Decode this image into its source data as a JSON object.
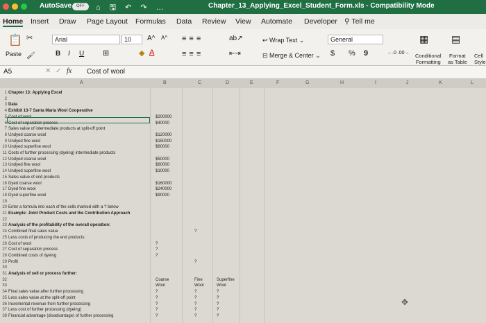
{
  "titlebar": {
    "autosave": "AutoSave",
    "toggle": "OFF",
    "quick": "⌂ 🖫 ↶ ↷ …",
    "doc_title": "Chapter_13_Applying_Excel_Student_Form.xls  -  Compatibility Mode"
  },
  "tabs": [
    "Home",
    "Insert",
    "Draw",
    "Page Layout",
    "Formulas",
    "Data",
    "Review",
    "View",
    "Automate",
    "Developer",
    "Tell me"
  ],
  "ribbon": {
    "paste": "Paste",
    "font": "Arial",
    "size": "10",
    "bold": "B",
    "italic": "I",
    "underline": "U",
    "wrap": "Wrap Text",
    "merge": "Merge & Center",
    "numfmt": "General",
    "currency": "$",
    "percent": "%",
    "comma": "9",
    "cond1": "Conditional",
    "cond2": "Formatting",
    "fmt1": "Format",
    "fmt2": "as Table",
    "cell1": "Cell",
    "cell2": "Style"
  },
  "formula": {
    "cell_ref": "A5",
    "fx": "fx",
    "value": "Cost of wool"
  },
  "columns": [
    "A",
    "B",
    "C",
    "D",
    "E",
    "F",
    "G",
    "H",
    "I",
    "J",
    "K",
    "L"
  ],
  "rows": [
    {
      "n": "1",
      "a": "Chapter 13: Applying Excel",
      "bold": true
    },
    {
      "n": "2",
      "a": ""
    },
    {
      "n": "3",
      "a": "Data",
      "bold": true
    },
    {
      "n": "4",
      "a": "Exhibit 13-7 Santa Maria Wool Cooperative",
      "bold": true
    },
    {
      "n": "5",
      "a": "Cost of wool",
      "b": "$200000"
    },
    {
      "n": "6",
      "a": "Cost of separation process",
      "b": "$40000"
    },
    {
      "n": "7",
      "a": "Sales value of intermediate products at split-off point"
    },
    {
      "n": "8",
      "a": "  Undyed coarse wool",
      "b": "$120000"
    },
    {
      "n": "9",
      "a": "  Undyed fine wool",
      "b": "$150000"
    },
    {
      "n": "10",
      "a": "  Undyed superfine wool",
      "b": "$60000"
    },
    {
      "n": "11",
      "a": "Costs of further processing (dyeing) intermediate products"
    },
    {
      "n": "12",
      "a": "  Undyed coarse wool",
      "b": "$50000"
    },
    {
      "n": "13",
      "a": "  Undyed fine wool",
      "b": "$60000"
    },
    {
      "n": "14",
      "a": "  Undyed superfine wool",
      "b": "$10000"
    },
    {
      "n": "15",
      "a": "Sales value of end products"
    },
    {
      "n": "16",
      "a": "  Dyed coarse wool",
      "b": "$160000"
    },
    {
      "n": "17",
      "a": "  Dyed fine wool",
      "b": "$240000"
    },
    {
      "n": "18",
      "a": "  Dyed superfine wool",
      "b": "$90000"
    },
    {
      "n": "19",
      "a": ""
    },
    {
      "n": "20",
      "a": "Enter a formula into each of the cells marked with a ? below"
    },
    {
      "n": "21",
      "a": "Example: Joint Product Costs and the Contribution Approach",
      "bold": true
    },
    {
      "n": "22",
      "a": ""
    },
    {
      "n": "23",
      "a": "Analysis of the profitability of the overall operation:",
      "bold": true
    },
    {
      "n": "24",
      "a": "Combined final sales value",
      "c": "?"
    },
    {
      "n": "25",
      "a": "Less costs of producing the end products:"
    },
    {
      "n": "26",
      "a": "  Cost of wool",
      "b": "?"
    },
    {
      "n": "27",
      "a": "  Cost of separation process",
      "b": "?"
    },
    {
      "n": "28",
      "a": "  Combined costs of dyeing",
      "b": "?"
    },
    {
      "n": "29",
      "a": "Profit",
      "c": "?"
    },
    {
      "n": "30",
      "a": ""
    },
    {
      "n": "31",
      "a": "Analysis of sell or process further:",
      "bold": true
    },
    {
      "n": "32",
      "a": "",
      "b": "Coarse",
      "c": "Fine",
      "d": "Superfine"
    },
    {
      "n": "33",
      "a": "",
      "b": "Wool",
      "c": "Wool",
      "d": "Wool"
    },
    {
      "n": "34",
      "a": "Final sales value after further processing",
      "b": "?",
      "c": "?",
      "d": "?"
    },
    {
      "n": "35",
      "a": "Less sales value at the split-off point",
      "b": "?",
      "c": "?",
      "d": "?"
    },
    {
      "n": "36",
      "a": "Incremental revenue from further processing",
      "b": "?",
      "c": "?",
      "d": "?"
    },
    {
      "n": "37",
      "a": "Less cost of further processing (dyeing)",
      "b": "?",
      "c": "?",
      "d": "?"
    },
    {
      "n": "38",
      "a": "Financial advantage (disadvantage) of further processing",
      "b": "?",
      "c": "?",
      "d": "?"
    }
  ]
}
